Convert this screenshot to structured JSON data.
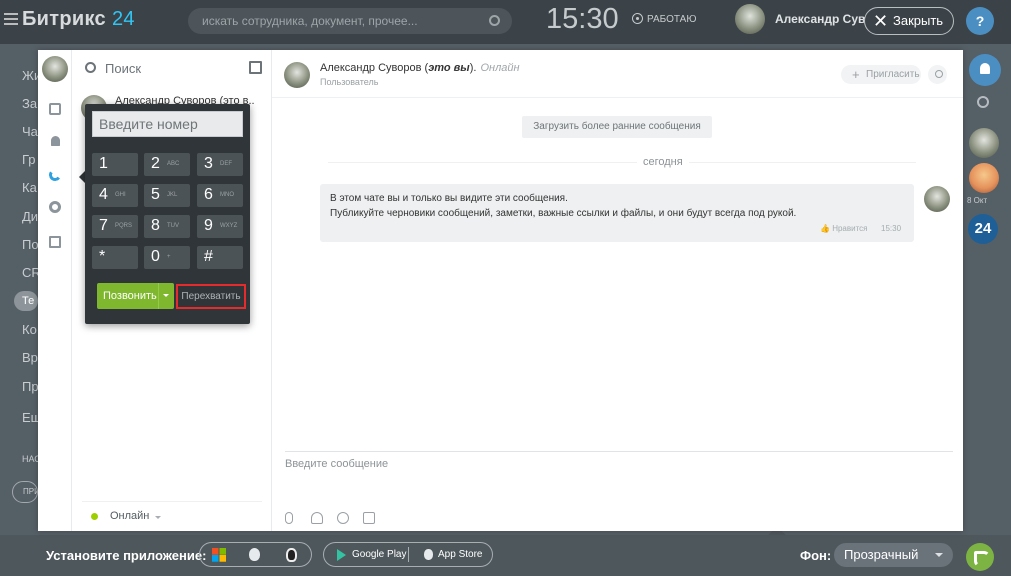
{
  "topbar": {
    "logo_main": "Битрикс",
    "logo_num": "24",
    "search_placeholder": "искать сотрудника, документ, прочее...",
    "clock": "15:30",
    "work_status": "РАБОТАЮ",
    "user_name": "Александр Суворов",
    "close_label": "Закрыть",
    "help": "?"
  },
  "bg_left": [
    "Жи",
    "За",
    "Ча",
    "Гр",
    "Ка",
    "Ди",
    "По",
    "CR",
    "Те",
    "Ко",
    "Вр",
    "Пр",
    "Ещ",
    "НАС",
    "ПРИ"
  ],
  "right_rail": {
    "date": "8 Окт",
    "b24": "24"
  },
  "messenger": {
    "list": {
      "search_placeholder": "Поиск",
      "first_chat": "Александр Суворов (это в...",
      "status": "Онлайн"
    },
    "dialpad": {
      "placeholder": "Введите номер",
      "keys": [
        {
          "d": "1",
          "l": ""
        },
        {
          "d": "2",
          "l": "ABC"
        },
        {
          "d": "3",
          "l": "DEF"
        },
        {
          "d": "4",
          "l": "GHI"
        },
        {
          "d": "5",
          "l": "JKL"
        },
        {
          "d": "6",
          "l": "MNO"
        },
        {
          "d": "7",
          "l": "PQRS"
        },
        {
          "d": "8",
          "l": "TUV"
        },
        {
          "d": "9",
          "l": "WXYZ"
        },
        {
          "d": "*",
          "l": ""
        },
        {
          "d": "0",
          "l": "+"
        },
        {
          "d": "#",
          "l": ""
        }
      ],
      "call_label": "Позвонить",
      "intercept_label": "Перехватить"
    },
    "chat": {
      "name": "Александр Суворов (",
      "self_mark": "это вы",
      "name_end": ").",
      "online": "Онлайн",
      "role": "Пользователь",
      "invite_label": "Пригласить",
      "load_older": "Загрузить более ранние сообщения",
      "day": "сегодня",
      "message_line1": "В этом чате вы и только вы видите эти сообщения.",
      "message_line2": "Публикуйте черновики сообщений, заметки, важные ссылки и файлы, и они будут всегда под рукой.",
      "like_label": "Нравится",
      "message_time": "15:30",
      "input_placeholder": "Введите сообщение"
    }
  },
  "bottombar": {
    "install_label": "Установите приложение:",
    "google_play": "Google Play",
    "app_store": "App Store",
    "bg_label": "Фон:",
    "bg_value": "Прозрачный"
  }
}
